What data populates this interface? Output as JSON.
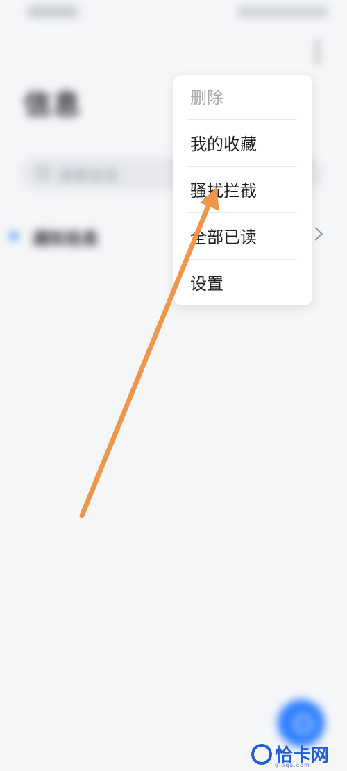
{
  "app": {
    "title": "信息"
  },
  "status_bar": {
    "left_text": "",
    "right_text": ""
  },
  "search": {
    "placeholder": "搜索信息"
  },
  "conversations": [
    {
      "label": "通知信息",
      "unread": true
    }
  ],
  "menu": {
    "items": [
      {
        "label": "删除",
        "enabled": false
      },
      {
        "label": "我的收藏",
        "enabled": true
      },
      {
        "label": "骚扰拦截",
        "enabled": true
      },
      {
        "label": "全部已读",
        "enabled": true
      },
      {
        "label": "设置",
        "enabled": true
      }
    ]
  },
  "icons": {
    "more": "more-vertical-icon",
    "search": "search-icon",
    "chevron": "chevron-right-icon",
    "compose": "compose-icon"
  },
  "annotation": {
    "type": "arrow",
    "color": "#f0964a"
  },
  "watermark": {
    "text": "恰卡网",
    "domain": "qiaqa.com"
  },
  "colors": {
    "accent": "#2f80ff",
    "menu_text": "#1f2023",
    "menu_disabled": "#a6a9ae"
  }
}
